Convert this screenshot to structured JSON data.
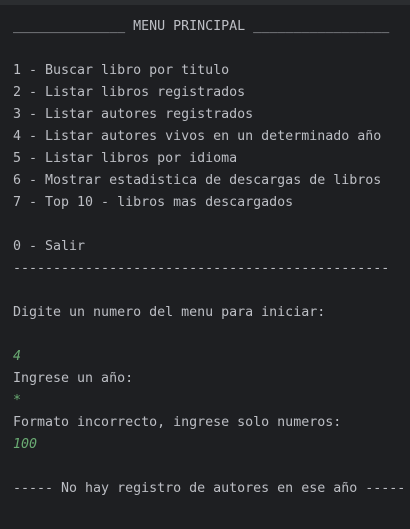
{
  "console": {
    "header": "______________ MENU PRINCIPAL _________________",
    "menu_items": [
      "1 - Buscar libro por titulo",
      "2 - Listar libros registrados",
      "3 - Listar autores registrados",
      "4 - Listar autores vivos en un determinado año",
      "5 - Listar libros por idioma",
      "6 - Mostrar estadistica de descargas de libros",
      "7 - Top 10 - libros mas descargados"
    ],
    "exit_item": "0 - Salir",
    "separator": "-----------------------------------------------",
    "prompt": "Digite un numero del menu para iniciar:",
    "user_input_1": "4",
    "year_prompt": "Ingrese un año:",
    "user_input_2": "*",
    "error_message": "Formato incorrecto, ingrese solo numeros:",
    "user_input_3": "100",
    "result_message": "----- No hay registro de autores en ese año -----"
  },
  "colors": {
    "background": "#1e1f22",
    "text": "#bcbec4",
    "input": "#6aab73"
  }
}
